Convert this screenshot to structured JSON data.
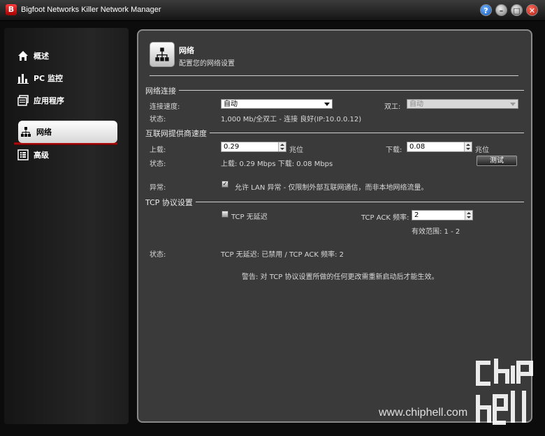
{
  "window": {
    "title": "Bigfoot Networks Killer Network Manager",
    "help_label": "?",
    "min_label": "–",
    "max_label": "□",
    "close_label": "✕"
  },
  "sidebar": {
    "items": [
      {
        "label": "概述",
        "icon": "home-icon"
      },
      {
        "label": "PC 监控",
        "icon": "bar-chart-icon"
      },
      {
        "label": "应用程序",
        "icon": "applications-icon"
      },
      {
        "label": "网络",
        "icon": "network-icon",
        "active": true
      },
      {
        "label": "高级",
        "icon": "advanced-list-icon"
      }
    ]
  },
  "header": {
    "title": "网络",
    "subtitle": "配置您的网络设置",
    "icon": "network-icon"
  },
  "network_connection": {
    "section_title": "网络连接",
    "speed_label": "连接速度:",
    "speed_value": "自动",
    "duplex_label": "双工:",
    "duplex_value": "自动",
    "status_label": "状态:",
    "status_value": "1,000 Mb/全双工 - 连接 良好(IP:10.0.0.12)"
  },
  "isp_speed": {
    "section_title": "互联网提供商速度",
    "upload_label": "上载:",
    "upload_value": "0.29",
    "upload_unit": "兆位",
    "download_label": "下载:",
    "download_value": "0.08",
    "download_unit": "兆位",
    "status_label": "状态:",
    "status_value": "上载: 0.29 Mbps 下载: 0.08 Mbps",
    "test_button": "测试",
    "exception_label": "异常:",
    "exception_text": "允许 LAN 异常 - 仅限制外部互联网通信，而非本地网络流量。",
    "exception_checked": true
  },
  "tcp": {
    "section_title": "TCP 协议设置",
    "nodelay_label": "TCP 无延迟",
    "nodelay_checked": false,
    "ack_label": "TCP ACK 频率:",
    "ack_value": "2",
    "range_text": "有效范围: 1 - 2",
    "status_label": "状态:",
    "status_value": "TCP 无延迟: 已禁用 / TCP ACK 频率: 2",
    "warning": "警告: 对 TCP 协议设置所做的任何更改需重新启动后才能生效。"
  },
  "watermark": {
    "text": "www.chiphell.com",
    "logo_text": "chiphell"
  },
  "colors": {
    "accent_red": "#c01010",
    "panel_bg": "#3a3a3a",
    "active_item_bg": "#ffffff"
  }
}
